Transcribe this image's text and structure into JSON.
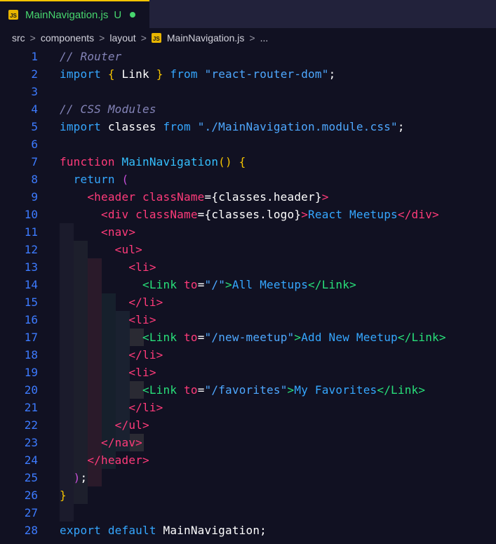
{
  "tab": {
    "file_icon": "JS",
    "file_name": "MainNavigation.js",
    "status": "U",
    "accent": "#47d66e"
  },
  "breadcrumb": {
    "items": [
      "src",
      "components",
      "layout",
      "MainNavigation.js",
      "..."
    ],
    "separator": ">"
  },
  "code": {
    "lines": [
      {
        "n": "1"
      },
      {
        "n": "2"
      },
      {
        "n": "3"
      },
      {
        "n": "4"
      },
      {
        "n": "5"
      },
      {
        "n": "6"
      },
      {
        "n": "7"
      },
      {
        "n": "8"
      },
      {
        "n": "9"
      },
      {
        "n": "10"
      },
      {
        "n": "11"
      },
      {
        "n": "12"
      },
      {
        "n": "13"
      },
      {
        "n": "14"
      },
      {
        "n": "15"
      },
      {
        "n": "16"
      },
      {
        "n": "17"
      },
      {
        "n": "18"
      },
      {
        "n": "19"
      },
      {
        "n": "20"
      },
      {
        "n": "21"
      },
      {
        "n": "22"
      },
      {
        "n": "23"
      },
      {
        "n": "24"
      },
      {
        "n": "25"
      },
      {
        "n": "26"
      },
      {
        "n": "27"
      },
      {
        "n": "28"
      }
    ],
    "l1_comment": "// Router",
    "l2_import": "import",
    "l2_lbrace": "{",
    "l2_link": " Link ",
    "l2_rbrace": "}",
    "l2_from": "from",
    "l2_str": "\"react-router-dom\"",
    "l2_semi": ";",
    "l4_comment": "// CSS Modules",
    "l5_import": "import",
    "l5_classes": " classes ",
    "l5_from": "from",
    "l5_str": "\"./MainNavigation.module.css\"",
    "l5_semi": ";",
    "l7_function": "function",
    "l7_name": " MainNavigation",
    "l7_parens": "()",
    "l7_brace": " {",
    "l8_return": "return",
    "l8_paren": " (",
    "l9_open": "<header",
    "l9_attr": " className",
    "l9_eq": "=",
    "l9_val": "{classes.header}",
    "l9_close": ">",
    "l10_open": "<div",
    "l10_attr": " className",
    "l10_eq": "=",
    "l10_val": "{classes.logo}",
    "l10_gt": ">",
    "l10_text": "React Meetups",
    "l10_end": "</div>",
    "l11": "<nav>",
    "l12": "<ul>",
    "l13": "<li>",
    "l14_lt": "<",
    "l14_comp": "Link",
    "l14_attr": " to",
    "l14_eq": "=",
    "l14_val": "\"/\"",
    "l14_gt": ">",
    "l14_text": "All Meetups",
    "l14_endlt": "</",
    "l14_endcomp": "Link",
    "l14_endgt": ">",
    "l15": "</li>",
    "l16": "<li>",
    "l17_val": "\"/new-meetup\"",
    "l17_text": "Add New Meetup",
    "l18": "</li>",
    "l19": "<li>",
    "l20_val": "\"/favorites\"",
    "l20_text": "My Favorites",
    "l21": "</li>",
    "l22": "</ul>",
    "l23": "</nav>",
    "l24": "</header>",
    "l25_paren": ")",
    "l25_semi": ";",
    "l26_brace": "}",
    "l28_export": "export",
    "l28_default": " default",
    "l28_name": " MainNavigation",
    "l28_semi": ";"
  }
}
